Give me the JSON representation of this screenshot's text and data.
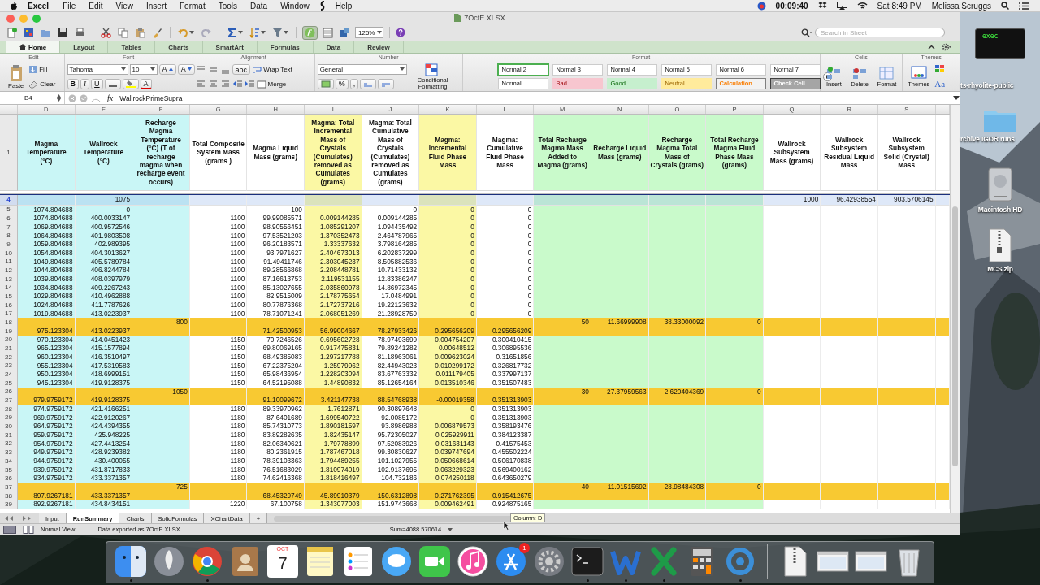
{
  "menubar": {
    "app": "Excel",
    "items": [
      {
        "kind": "menu",
        "label": "File"
      },
      {
        "kind": "menu",
        "label": "Edit"
      },
      {
        "kind": "menu",
        "label": "View"
      },
      {
        "kind": "menu",
        "label": "Insert"
      },
      {
        "kind": "menu",
        "label": "Format"
      },
      {
        "kind": "menu",
        "label": "Tools"
      },
      {
        "kind": "menu",
        "label": "Data"
      },
      {
        "kind": "menu",
        "label": "Window"
      },
      {
        "kind": "script"
      },
      {
        "kind": "menu",
        "label": "Help"
      }
    ],
    "timer": "00:09:40",
    "clock": "Sat 8:49 PM",
    "user": "Melissa Scruggs"
  },
  "window": {
    "title": "7OctE.XLSX",
    "toolbar": {
      "formula_toggle_on": true,
      "zoom": "125%",
      "search_placeholder": "Search in Sheet"
    },
    "ribbon": {
      "tabs": [
        {
          "label": "Home",
          "selected": true
        },
        {
          "label": "Layout",
          "selected": false
        },
        {
          "label": "Tables",
          "selected": false
        },
        {
          "label": "Charts",
          "selected": false
        },
        {
          "label": "SmartArt",
          "selected": false
        },
        {
          "label": "Formulas",
          "selected": false
        },
        {
          "label": "Data",
          "selected": false
        },
        {
          "label": "Review",
          "selected": false
        }
      ],
      "edit": {
        "label": "Edit",
        "paste": "Paste",
        "fill": "Fill",
        "clear": "Clear"
      },
      "font": {
        "label": "Font",
        "name": "Tahoma",
        "size": "10",
        "grow": "A",
        "shrink": "A",
        "bold": "B",
        "italic": "I",
        "underline": "U",
        "color_button": "A"
      },
      "alignment": {
        "label": "Alignment",
        "orientation": "abc",
        "wrap": "Wrap Text",
        "merge": "Merge"
      },
      "number": {
        "label": "Number",
        "format": "General",
        "percent": "%",
        "comma": ",",
        "conditional": "Conditional Formatting"
      },
      "format": {
        "label": "Format",
        "styles": [
          {
            "label": "Normal 2",
            "kind": "normal",
            "selected": true
          },
          {
            "label": "Normal 3",
            "kind": "normal",
            "selected": false
          },
          {
            "label": "Normal 4",
            "kind": "normal",
            "selected": false
          },
          {
            "label": "Normal 5",
            "kind": "normal",
            "selected": false
          },
          {
            "label": "Normal 6",
            "kind": "normal",
            "selected": false
          },
          {
            "label": "Normal 7",
            "kind": "normal",
            "selected": false
          },
          {
            "label": "Normal",
            "kind": "normal",
            "selected": false
          },
          {
            "label": "Bad",
            "kind": "bad",
            "selected": false
          },
          {
            "label": "Good",
            "kind": "good",
            "selected": false
          },
          {
            "label": "Neutral",
            "kind": "neutral",
            "selected": false
          },
          {
            "label": "Calculation",
            "kind": "calculation",
            "selected": false
          },
          {
            "label": "Check Cell",
            "kind": "check",
            "selected": false
          }
        ]
      },
      "cells": {
        "label": "Cells",
        "buttons": [
          "Insert",
          "Delete",
          "Format"
        ]
      },
      "themes": {
        "label": "Themes",
        "button": "Themes",
        "fonts": "Aa"
      }
    },
    "formula_bar": {
      "name_box": "B4",
      "fx": "fx",
      "content": "WallrockPrimeSupra"
    },
    "sheet": {
      "header_row": "1",
      "columns": [
        {
          "letter": "D",
          "header": "Magma Temperature (°C)",
          "color": "#c9f6f6"
        },
        {
          "letter": "E",
          "header": "Wallrock Temperature (°C)",
          "color": "#c9f6f6"
        },
        {
          "letter": "F",
          "header": "Recharge Magma Temperature (°C) (T of recharge magma when recharge event occurs)",
          "color": "#c9f6f6"
        },
        {
          "letter": "G",
          "header": "Total Composite System Mass (grams )",
          "color": "#ffffff"
        },
        {
          "letter": "H",
          "header": "Magma Liquid Mass (grams)",
          "color": "#ffffff"
        },
        {
          "letter": "I",
          "header": "Magma: Total Incremental Mass of Crystals (Cumulates) removed as Cumulates (grams)",
          "color": "#fbf8a4"
        },
        {
          "letter": "J",
          "header": "Magma: Total Cumulative Mass of Crystals (Cumulates) removed as Cumulates (grams)",
          "color": "#ffffff"
        },
        {
          "letter": "K",
          "header": "Magma: Incremental Fluid Phase Mass",
          "color": "#fbf8a4"
        },
        {
          "letter": "L",
          "header": "Magma: Cumulative Fluid Phase Mass",
          "color": "#ffffff"
        },
        {
          "letter": "M",
          "header": "Total Recharge Magma Mass Added to Magma (grams)",
          "color": "#c9facb"
        },
        {
          "letter": "N",
          "header": "Recharge Liquid Mass (grams)",
          "color": "#c9facb"
        },
        {
          "letter": "O",
          "header": "Recharge Magma Total Mass of Crystals (grams)",
          "color": "#c9facb"
        },
        {
          "letter": "P",
          "header": "Total Recharge Magma Fluid Phase Mass (grams)",
          "color": "#c9facb"
        },
        {
          "letter": "Q",
          "header": "Wallrock Subsystem Mass (grams)",
          "color": "#ffffff"
        },
        {
          "letter": "R",
          "header": "Wallrock Subsystem Residual Liquid Mass",
          "color": "#ffffff"
        },
        {
          "letter": "S",
          "header": "Wallrock Subsystem Solid (Crystal) Mass",
          "color": "#ffffff"
        }
      ],
      "rows": [
        {
          "number": "4",
          "kind": "data",
          "selected": true,
          "cells": {
            "E": "1075",
            "Q": "1000",
            "R": "96.42938554",
            "S": "903.5706145"
          }
        },
        {
          "number": "5",
          "kind": "data",
          "selected": false,
          "cells": {
            "D": "1074.804688",
            "E": "0",
            "H": "100",
            "J": "0",
            "K": "0",
            "L": "0"
          }
        },
        {
          "number": "6",
          "kind": "data",
          "selected": false,
          "cells": {
            "D": "1074.804688",
            "E": "400.0033147",
            "G": "1100",
            "H": "99.99085571",
            "I": "0.009144285",
            "J": "0.009144285",
            "K": "0",
            "L": "0"
          }
        },
        {
          "number": "7",
          "kind": "data",
          "selected": false,
          "cells": {
            "D": "1069.804688",
            "E": "400.9572546",
            "G": "1100",
            "H": "98.90556451",
            "I": "1.085291207",
            "J": "1.094435492",
            "K": "0",
            "L": "0"
          }
        },
        {
          "number": "8",
          "kind": "data",
          "selected": false,
          "cells": {
            "D": "1064.804688",
            "E": "401.9803508",
            "G": "1100",
            "H": "97.53521203",
            "I": "1.370352473",
            "J": "2.464787965",
            "K": "0",
            "L": "0"
          }
        },
        {
          "number": "9",
          "kind": "data",
          "selected": false,
          "cells": {
            "D": "1059.804688",
            "E": "402.989395",
            "G": "1100",
            "H": "96.20183571",
            "I": "1.33337632",
            "J": "3.798164285",
            "K": "0",
            "L": "0"
          }
        },
        {
          "number": "10",
          "kind": "data",
          "selected": false,
          "cells": {
            "D": "1054.804688",
            "E": "404.3013627",
            "G": "1100",
            "H": "93.7971627",
            "I": "2.404673013",
            "J": "6.202837299",
            "K": "0",
            "L": "0"
          }
        },
        {
          "number": "11",
          "kind": "data",
          "selected": false,
          "cells": {
            "D": "1049.804688",
            "E": "405.5789784",
            "G": "1100",
            "H": "91.49411746",
            "I": "2.303045237",
            "J": "8.505882536",
            "K": "0",
            "L": "0"
          }
        },
        {
          "number": "12",
          "kind": "data",
          "selected": false,
          "cells": {
            "D": "1044.804688",
            "E": "406.8244784",
            "G": "1100",
            "H": "89.28566868",
            "I": "2.208448781",
            "J": "10.71433132",
            "K": "0",
            "L": "0"
          }
        },
        {
          "number": "13",
          "kind": "data",
          "selected": false,
          "cells": {
            "D": "1039.804688",
            "E": "408.0397979",
            "G": "1100",
            "H": "87.16613753",
            "I": "2.119531155",
            "J": "12.83386247",
            "K": "0",
            "L": "0"
          }
        },
        {
          "number": "14",
          "kind": "data",
          "selected": false,
          "cells": {
            "D": "1034.804688",
            "E": "409.2267243",
            "G": "1100",
            "H": "85.13027655",
            "I": "2.035860978",
            "J": "14.86972345",
            "K": "0",
            "L": "0"
          }
        },
        {
          "number": "15",
          "kind": "data",
          "selected": false,
          "cells": {
            "D": "1029.804688",
            "E": "410.4962888",
            "G": "1100",
            "H": "82.9515009",
            "I": "2.178775654",
            "J": "17.0484991",
            "K": "0",
            "L": "0"
          }
        },
        {
          "number": "16",
          "kind": "data",
          "selected": false,
          "cells": {
            "D": "1024.804688",
            "E": "411.7787626",
            "G": "1100",
            "H": "80.77876368",
            "I": "2.172737216",
            "J": "19.22123632",
            "K": "0",
            "L": "0"
          }
        },
        {
          "number": "17",
          "kind": "data",
          "selected": false,
          "cells": {
            "D": "1019.804688",
            "E": "413.0223937",
            "G": "1100",
            "H": "78.71071241",
            "I": "2.068051269",
            "J": "21.28928759",
            "K": "0",
            "L": "0"
          }
        },
        {
          "number": "18",
          "kind": "recharge",
          "selected": false,
          "cells": {
            "F": "800",
            "M": "50",
            "N": "11.66999908",
            "O": "38.33000092",
            "P": "0"
          }
        },
        {
          "number": "19",
          "kind": "recharge",
          "selected": false,
          "cells": {
            "D": "975.123304",
            "E": "413.0223937",
            "H": "71.42500953",
            "I": "56.99004667",
            "J": "78.27933426",
            "K": "0.295656209",
            "L": "0.295656209"
          }
        },
        {
          "number": "20",
          "kind": "data",
          "selected": false,
          "cells": {
            "D": "970.123304",
            "E": "414.0451423",
            "G": "1150",
            "H": "70.7246526",
            "I": "0.695602728",
            "J": "78.97493699",
            "K": "0.004754207",
            "L": "0.300410415"
          }
        },
        {
          "number": "21",
          "kind": "data",
          "selected": false,
          "cells": {
            "D": "965.123304",
            "E": "415.1577894",
            "G": "1150",
            "H": "69.80069165",
            "I": "0.917475831",
            "J": "79.89241282",
            "K": "0.00648512",
            "L": "0.306895536"
          }
        },
        {
          "number": "22",
          "kind": "data",
          "selected": false,
          "cells": {
            "D": "960.123304",
            "E": "416.3510497",
            "G": "1150",
            "H": "68.49385083",
            "I": "1.297217788",
            "J": "81.18963061",
            "K": "0.009623024",
            "L": "0.31651856"
          }
        },
        {
          "number": "23",
          "kind": "data",
          "selected": false,
          "cells": {
            "D": "955.123304",
            "E": "417.5319583",
            "G": "1150",
            "H": "67.22375204",
            "I": "1.25979962",
            "J": "82.44943023",
            "K": "0.010299172",
            "L": "0.326817732"
          }
        },
        {
          "number": "24",
          "kind": "data",
          "selected": false,
          "cells": {
            "D": "950.123304",
            "E": "418.6999151",
            "G": "1150",
            "H": "65.98436954",
            "I": "1.228203094",
            "J": "83.67763332",
            "K": "0.011179405",
            "L": "0.337997137"
          }
        },
        {
          "number": "25",
          "kind": "data",
          "selected": false,
          "cells": {
            "D": "945.123304",
            "E": "419.9128375",
            "G": "1150",
            "H": "64.52195088",
            "I": "1.44890832",
            "J": "85.12654164",
            "K": "0.013510346",
            "L": "0.351507483"
          }
        },
        {
          "number": "26",
          "kind": "recharge",
          "selected": false,
          "cells": {
            "F": "1050",
            "M": "30",
            "N": "27.37959563",
            "O": "2.620404369",
            "P": "0"
          }
        },
        {
          "number": "27",
          "kind": "recharge",
          "selected": false,
          "cells": {
            "D": "979.9759172",
            "E": "419.9128375",
            "H": "91.10099672",
            "I": "3.421147738",
            "J": "88.54768938",
            "K": "-0.00019358",
            "L": "0.351313903"
          }
        },
        {
          "number": "28",
          "kind": "data",
          "selected": false,
          "cells": {
            "D": "974.9759172",
            "E": "421.4166251",
            "G": "1180",
            "H": "89.33970962",
            "I": "1.7612871",
            "J": "90.30897648",
            "K": "0",
            "L": "0.351313903"
          }
        },
        {
          "number": "29",
          "kind": "data",
          "selected": false,
          "cells": {
            "D": "969.9759172",
            "E": "422.9120267",
            "G": "1180",
            "H": "87.6401689",
            "I": "1.699540722",
            "J": "92.0085172",
            "K": "0",
            "L": "0.351313903"
          }
        },
        {
          "number": "30",
          "kind": "data",
          "selected": false,
          "cells": {
            "D": "964.9759172",
            "E": "424.4394355",
            "G": "1180",
            "H": "85.74310773",
            "I": "1.890181597",
            "J": "93.8986988",
            "K": "0.006879573",
            "L": "0.358193476"
          }
        },
        {
          "number": "31",
          "kind": "data",
          "selected": false,
          "cells": {
            "D": "959.9759172",
            "E": "425.948225",
            "G": "1180",
            "H": "83.89282635",
            "I": "1.82435147",
            "J": "95.72305027",
            "K": "0.025929911",
            "L": "0.384123387"
          }
        },
        {
          "number": "32",
          "kind": "data",
          "selected": false,
          "cells": {
            "D": "954.9759172",
            "E": "427.4413254",
            "G": "1180",
            "H": "82.06340621",
            "I": "1.79778899",
            "J": "97.52083926",
            "K": "0.031631143",
            "L": "0.41575453"
          }
        },
        {
          "number": "33",
          "kind": "data",
          "selected": false,
          "cells": {
            "D": "949.9759172",
            "E": "428.9239382",
            "G": "1180",
            "H": "80.2361915",
            "I": "1.787467018",
            "J": "99.30830627",
            "K": "0.039747694",
            "L": "0.455502224"
          }
        },
        {
          "number": "34",
          "kind": "data",
          "selected": false,
          "cells": {
            "D": "944.9759172",
            "E": "430.400055",
            "G": "1180",
            "H": "78.39103363",
            "I": "1.794489255",
            "J": "101.1027955",
            "K": "0.050668614",
            "L": "0.506170838"
          }
        },
        {
          "number": "35",
          "kind": "data",
          "selected": false,
          "cells": {
            "D": "939.9759172",
            "E": "431.8717833",
            "G": "1180",
            "H": "76.51683029",
            "I": "1.810974019",
            "J": "102.9137695",
            "K": "0.063229323",
            "L": "0.569400162"
          }
        },
        {
          "number": "36",
          "kind": "data",
          "selected": false,
          "cells": {
            "D": "934.9759172",
            "E": "433.3371357",
            "G": "1180",
            "H": "74.62416368",
            "I": "1.818416497",
            "J": "104.732186",
            "K": "0.074250118",
            "L": "0.643650279"
          }
        },
        {
          "number": "37",
          "kind": "recharge",
          "selected": false,
          "cells": {
            "F": "725",
            "M": "40",
            "N": "11.01515692",
            "O": "28.98484308",
            "P": "0"
          }
        },
        {
          "number": "38",
          "kind": "recharge",
          "selected": false,
          "cells": {
            "D": "897.9267181",
            "E": "433.3371357",
            "H": "68.45329749",
            "I": "45.89910379",
            "J": "150.6312898",
            "K": "0.271762395",
            "L": "0.915412675"
          }
        },
        {
          "number": "39",
          "kind": "data",
          "selected": false,
          "cells": {
            "D": "892.9267181",
            "E": "434.8434151",
            "G": "1220",
            "H": "67.100758",
            "I": "1.343077003",
            "J": "151.9743668",
            "K": "0.009462491",
            "L": "0.924875165"
          }
        }
      ]
    },
    "sheet_tabs": [
      {
        "label": "Input",
        "selected": false
      },
      {
        "label": "RunSummary",
        "selected": true
      },
      {
        "label": "Charts",
        "selected": false
      },
      {
        "label": "SolidFormulas",
        "selected": false
      },
      {
        "label": "XChartData",
        "selected": false
      }
    ],
    "add_sheet": "+",
    "tooltip": "Column: D",
    "status_bar": {
      "view": "Normal View",
      "message": "Data exported as 7OctE.XLSX",
      "sum": "Sum=4088.570614"
    }
  },
  "desktop": {
    "items": [
      {
        "kind": "terminal",
        "label": "exec"
      },
      {
        "kind": "caption",
        "label": "ts-rhyolite-public"
      },
      {
        "kind": "folder",
        "label": "rchive IGOR runs"
      },
      {
        "kind": "disk",
        "label": "Macintosh HD"
      },
      {
        "kind": "zip",
        "label": "MCS.zip"
      }
    ]
  },
  "dock": [
    {
      "kind": "finder",
      "running": true
    },
    {
      "kind": "launchpad",
      "running": false
    },
    {
      "kind": "browser",
      "running": true
    },
    {
      "kind": "contacts",
      "running": false
    },
    {
      "kind": "calendar",
      "running": false,
      "month": "OCT",
      "day": "7"
    },
    {
      "kind": "notes",
      "running": false
    },
    {
      "kind": "reminders",
      "running": false
    },
    {
      "kind": "messages",
      "running": false
    },
    {
      "kind": "facetime",
      "running": false
    },
    {
      "kind": "music",
      "running": false
    },
    {
      "kind": "appstore",
      "running": false,
      "badge": "1"
    },
    {
      "kind": "settings",
      "running": false
    },
    {
      "kind": "terminal",
      "running": true
    },
    {
      "kind": "zigzag",
      "running": true
    },
    {
      "kind": "cross",
      "running": true
    },
    {
      "kind": "calculator",
      "running": false
    },
    {
      "kind": "ring",
      "running": true
    },
    {
      "kind": "separator"
    },
    {
      "kind": "zip",
      "running": false
    },
    {
      "kind": "window",
      "running": false
    },
    {
      "kind": "window",
      "running": false
    },
    {
      "kind": "trash",
      "running": false
    }
  ]
}
